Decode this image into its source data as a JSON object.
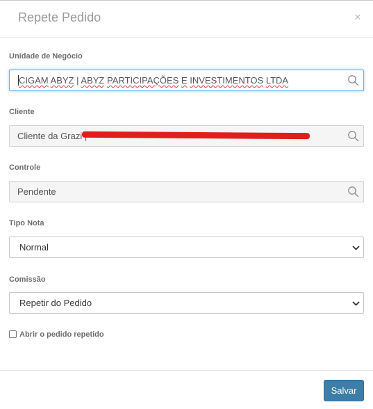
{
  "modal": {
    "title": "Repete Pedido",
    "close_symbol": "×"
  },
  "fields": {
    "unidade": {
      "label": "Unidade de Negócio",
      "value_parts": [
        "CIGAM",
        "ABYZ",
        "|",
        "ABYZ",
        "PARTICIPAÇÕES",
        "E",
        "INVESTIMENTOS",
        "LTDA"
      ],
      "icon": "search-icon"
    },
    "cliente": {
      "label": "Cliente",
      "value": "Cliente da Grazi |",
      "redacted": true,
      "icon": "search-icon"
    },
    "controle": {
      "label": "Controle",
      "value": "Pendente",
      "icon": "search-icon"
    },
    "tipo_nota": {
      "label": "Tipo Nota",
      "selected": "Normal"
    },
    "comissao": {
      "label": "Comissão",
      "selected": "Repetir do Pedido"
    }
  },
  "checkbox": {
    "label": "Abrir o pedido repetido",
    "checked": false
  },
  "footer": {
    "save_label": "Salvar"
  },
  "colors": {
    "accent": "#3c7ea8",
    "focus_border": "#66afe9",
    "redaction": "#e01e1e"
  }
}
